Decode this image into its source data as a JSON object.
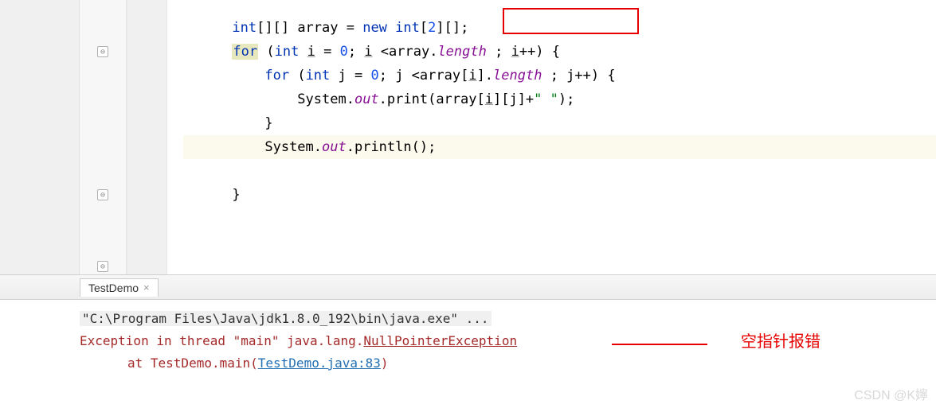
{
  "code": {
    "line1_a": "int",
    "line1_b": "[][] array = ",
    "line1_c": "new int",
    "line1_d": "[",
    "line1_e": "2",
    "line1_f": "][];",
    "line2_a": "for",
    "line2_b": " (",
    "line2_c": "int",
    "line2_d": " i = ",
    "line2_e": "0",
    "line2_f": "; i <array.",
    "line2_g": "length",
    "line2_h": " ; i++) {",
    "line3_a": "for",
    "line3_b": " (",
    "line3_c": "int",
    "line3_d": " j = ",
    "line3_e": "0",
    "line3_f": "; j <array[i].",
    "line3_g": "length",
    "line3_h": " ; j++) {",
    "line4_a": "System.",
    "line4_b": "out",
    "line4_c": ".print(array[i][j]+",
    "line4_d": "\" \"",
    "line4_e": ");",
    "line5": "}",
    "line6_a": "System.",
    "line6_b": "out",
    "line6_c": ".println();",
    "line7": "}"
  },
  "tab": {
    "label": "TestDemo",
    "close": "×"
  },
  "console": {
    "cmd": "\"C:\\Program Files\\Java\\jdk1.8.0_192\\bin\\java.exe\" ...",
    "err_prefix": "Exception in thread \"main\" java.lang.",
    "err_name": "NullPointerException ",
    "at_prefix": "at TestDemo.main(",
    "at_link": "TestDemo.java:83",
    "at_suffix": ")"
  },
  "annotation": "空指针报错",
  "watermark": "CSDN @K嬣"
}
